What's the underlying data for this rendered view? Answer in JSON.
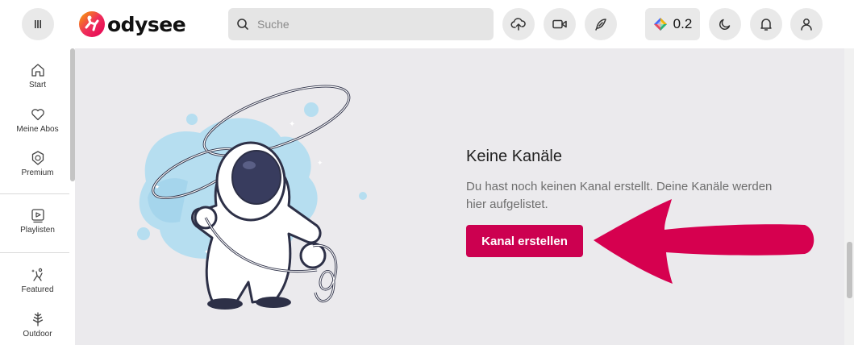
{
  "header": {
    "menu_icon": "menu-icon",
    "logo": {
      "text": "odysee"
    },
    "search": {
      "placeholder": "Suche",
      "value": ""
    },
    "upload_icon": "cloud-upload-icon",
    "video_icon": "video-camera-icon",
    "post_icon": "feather-pen-icon",
    "credits": {
      "value": "0.2",
      "icon": "lbc-credits-icon"
    },
    "theme_icon": "moon-icon",
    "notifications_icon": "bell-icon",
    "account_icon": "user-icon"
  },
  "sidebar": {
    "items": [
      {
        "label": "Start",
        "icon": "home-icon"
      },
      {
        "label": "Meine Abos",
        "icon": "heart-icon"
      },
      {
        "label": "Premium",
        "icon": "premium-badge-icon"
      },
      {
        "label": "Playlisten",
        "icon": "playlist-icon"
      },
      {
        "label": "Featured",
        "icon": "featured-icon"
      },
      {
        "label": "Outdoor",
        "icon": "tree-icon"
      }
    ]
  },
  "main": {
    "empty_state": {
      "title": "Keine Kanäle",
      "description": "Du hast noch keinen Kanal erstellt. Deine Kanäle werden hier aufgelistet.",
      "button_label": "Kanal erstellen"
    },
    "illustration_icon": "astronaut-lasso-illustration",
    "arrow_icon": "pointer-arrow-icon"
  },
  "colors": {
    "accent": "#cc0050",
    "header_bg": "#ffffff",
    "page_bg": "#ebeaed",
    "button_bg": "#e9e9e9"
  }
}
